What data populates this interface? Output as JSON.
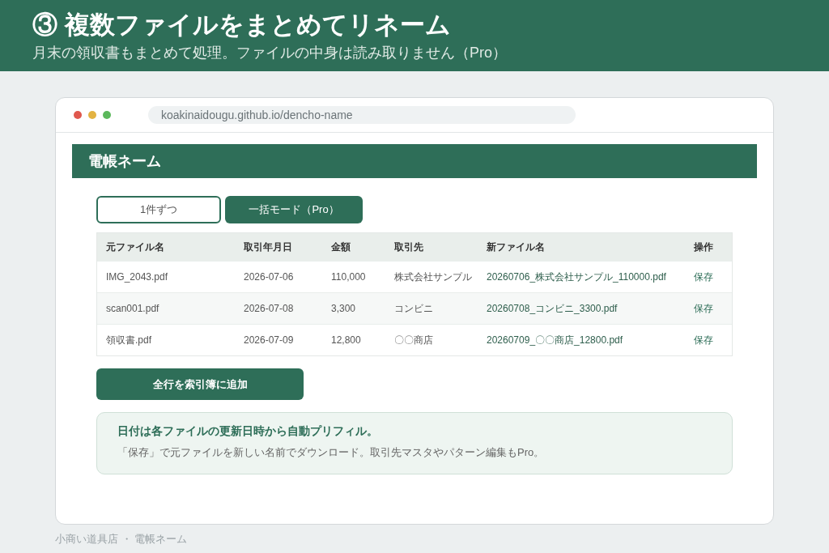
{
  "banner": {
    "title": "③ 複数ファイルをまとめてリネーム",
    "subtitle": "月末の領収書もまとめて処理。ファイルの中身は読み取りません（Pro）"
  },
  "browser": {
    "url": "koakinaidougu.github.io/dencho-name"
  },
  "app": {
    "title": "電帳ネーム",
    "tabs": [
      {
        "label": "1件ずつ",
        "selected": false
      },
      {
        "label": "一括モード（Pro）",
        "selected": true
      }
    ],
    "table": {
      "columns": [
        "元ファイル名",
        "取引年月日",
        "金額",
        "取引先",
        "新ファイル名",
        "操作"
      ],
      "rows": [
        {
          "cells": [
            "IMG_2043.pdf",
            "2026-07-06",
            "110,000",
            "株式会社サンプル",
            "20260706_株式会社サンプル_110000.pdf"
          ],
          "action": "保存"
        },
        {
          "cells": [
            "scan001.pdf",
            "2026-07-08",
            "3,300",
            "コンビニ",
            "20260708_コンビニ_3300.pdf"
          ],
          "action": "保存"
        },
        {
          "cells": [
            "領収書.pdf",
            "2026-07-09",
            "12,800",
            "〇〇商店",
            "20260709_〇〇商店_12800.pdf"
          ],
          "action": "保存"
        }
      ]
    },
    "add_button": "全行を索引簿に追加",
    "info": {
      "title": "日付は各ファイルの更新日時から自動プリフィル。",
      "text": "「保存」で元ファイルを新しい名前でダウンロード。取引先マスタやパターン編集もPro。"
    }
  },
  "footer": "小商い道具店 ・ 電帳ネーム"
}
